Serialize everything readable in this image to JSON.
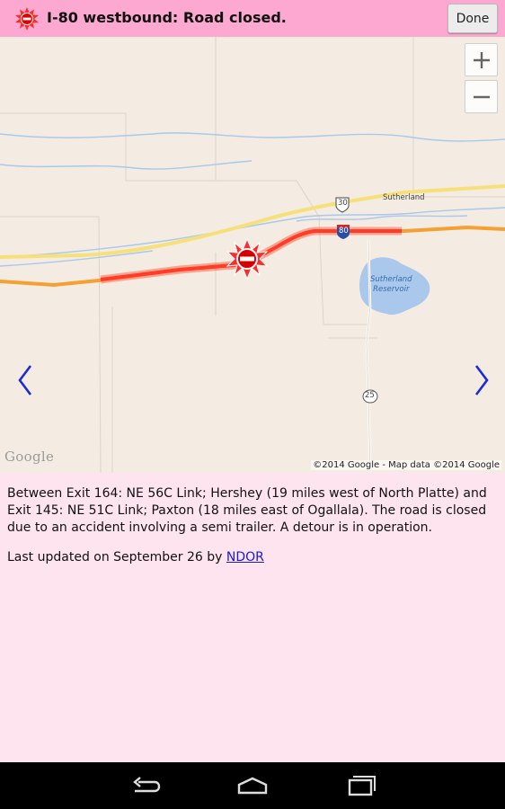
{
  "header": {
    "title": "I-80 westbound: Road closed.",
    "done_label": "Done"
  },
  "map": {
    "zoom_in": "+",
    "zoom_out": "−",
    "google_logo": "Google",
    "attribution": "©2014 Google - Map data ©2014 Google",
    "place_labels": {
      "sutherland": "Sutherland",
      "reservoir_line1": "Sutherland",
      "reservoir_line2": "Reservoir"
    },
    "shields": {
      "us30": "30",
      "i80": "80",
      "ne25": "25"
    }
  },
  "description": "Between Exit 164: NE 56C Link; Hershey (19 miles west of North Platte) and Exit 145: NE 51C Link; Paxton (18 miles east of Ogallala). The road is closed due to an accident involving a semi trailer. A detour is in operation.",
  "updated": {
    "prefix": "Last updated on September 26 by ",
    "link_label": "NDOR"
  },
  "icons": [
    "road-closed-icon",
    "chevron-left-icon",
    "chevron-right-icon",
    "back-icon",
    "home-icon",
    "recent-apps-icon"
  ],
  "colors": {
    "header_bg": "#fca8d0",
    "body_bg": "#fde4ee",
    "closure_red": "#ff3b2a",
    "highway_orange": "#f7a23a",
    "link_blue": "#1a1ad0"
  }
}
